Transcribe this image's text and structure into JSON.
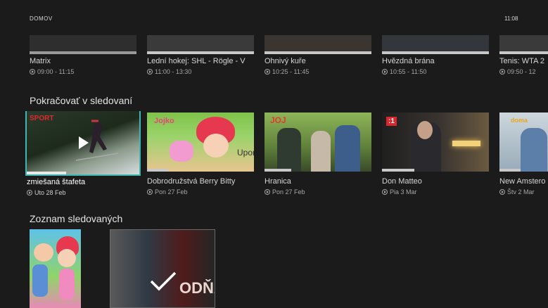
{
  "header": {
    "breadcrumb": "DOMOV",
    "clock": "11:08"
  },
  "row1": {
    "items": [
      {
        "title": "Matrix",
        "time": "09:00 - 11:15"
      },
      {
        "title": "Lední hokej: SHL - Rögle - V",
        "time": "11:00 - 13:30"
      },
      {
        "title": "Ohnivý kuře",
        "time": "10:25 - 11:45"
      },
      {
        "title": "Hvězdná brána",
        "time": "10:55 - 11:50"
      },
      {
        "title": "Tenis: WTA 2",
        "time": "09:50 - 12"
      }
    ]
  },
  "continue": {
    "heading": "Pokračovať v sledovaní",
    "items": [
      {
        "title": "zmiešaná štafeta",
        "date": "Uto 28 Feb",
        "channel": "SPORT",
        "progress": 0.35
      },
      {
        "title": "Dobrodružstvá Berry Bitty",
        "date": "Pon 27 Feb",
        "channel": "Jojko",
        "overlay": "UporeS",
        "progress": 0.2
      },
      {
        "title": "Hranica",
        "date": "Pon 27 Feb",
        "channel": "JOJ",
        "progress": 0.25
      },
      {
        "title": "Don Matteo",
        "date": "Pia 3 Mar",
        "channel": ":1",
        "progress": 0.3
      },
      {
        "title": "New Amstero",
        "date": "Štv 2 Mar",
        "channel": "doma",
        "progress": 0.2
      }
    ]
  },
  "watchlist": {
    "heading": "Zoznam sledovaných",
    "poster2_text": "ODŇA"
  },
  "colors": {
    "focus": "#3fb6b0",
    "background": "#1b1b1b"
  }
}
